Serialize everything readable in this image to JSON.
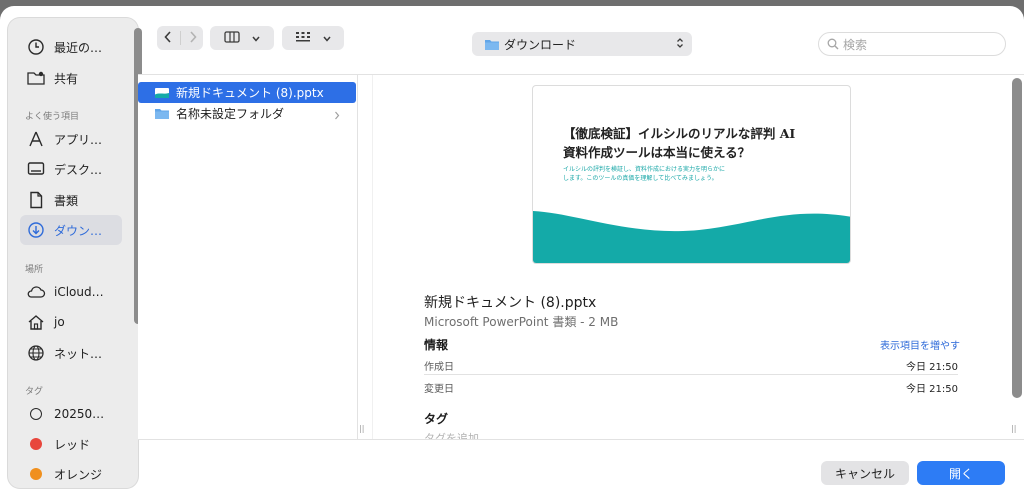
{
  "sidebar": {
    "recents": "最近の…",
    "shared": "共有",
    "favorites_header": "よく使う項目",
    "favorites": [
      "アプリ…",
      "デスク…",
      "書類",
      "ダウン…"
    ],
    "locations_header": "場所",
    "locations": [
      "iCloud…",
      "jo",
      "ネット…"
    ],
    "tags_header": "タグ",
    "tags": [
      {
        "label": "20250…",
        "color": "outline"
      },
      {
        "label": "レッド",
        "color": "#e8463c"
      },
      {
        "label": "オレンジ",
        "color": "#f0901e"
      }
    ]
  },
  "toolbar": {
    "location": "ダウンロード",
    "search_placeholder": "検索"
  },
  "files": [
    {
      "name": "新規ドキュメント (8).pptx",
      "selected": true
    },
    {
      "name": "名称未設定フォルダ",
      "selected": false
    }
  ],
  "preview": {
    "slide_title_line1": "【徹底検証】イルシルのリアルな評判 AI",
    "slide_title_line2": "資料作成ツールは本当に使える？",
    "slide_sub_line1": "イルシルの評判を検証し、資料作成における実力を明らかに",
    "slide_sub_line2": "します。このツールの真価を理解して比べてみましょう。",
    "accent_color": "#14aaa8",
    "file_name": "新規ドキュメント (8).pptx",
    "file_type": "Microsoft PowerPoint 書類 - 2 MB",
    "info_header": "情報",
    "more_link": "表示項目を増やす",
    "created_label": "作成日",
    "created_value": "今日 21:50",
    "modified_label": "変更日",
    "modified_value": "今日 21:50",
    "tags_header": "タグ",
    "tags_placeholder": "タグを追加"
  },
  "buttons": {
    "cancel": "キャンセル",
    "open": "開く"
  }
}
